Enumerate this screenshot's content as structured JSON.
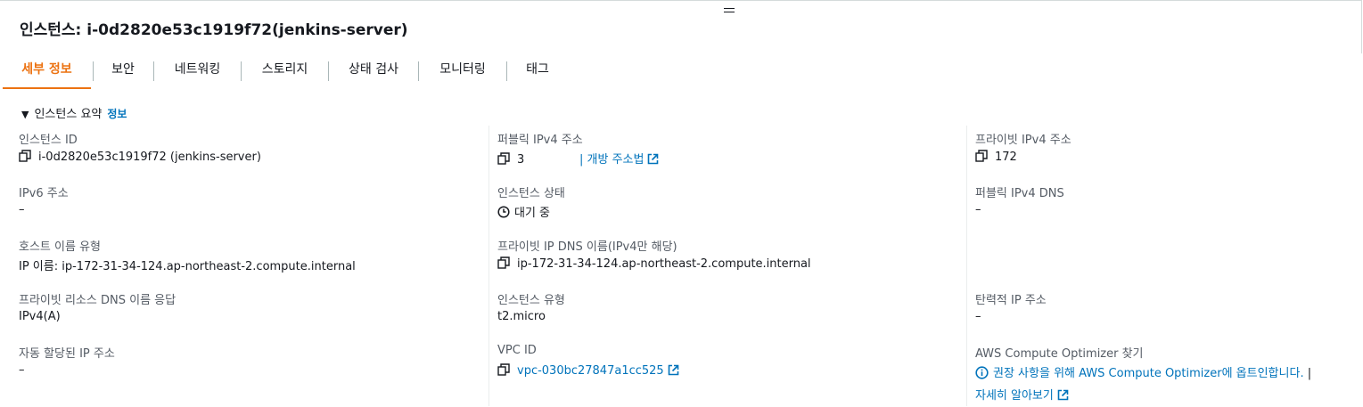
{
  "header": {
    "title": "인스턴스: i-0d2820e53c1919f72(jenkins-server)"
  },
  "tabs": [
    {
      "label": "세부 정보",
      "active": true
    },
    {
      "label": "보안"
    },
    {
      "label": "네트워킹"
    },
    {
      "label": "스토리지"
    },
    {
      "label": "상태 검사"
    },
    {
      "label": "모니터링"
    },
    {
      "label": "태그"
    }
  ],
  "summary": {
    "title": "인스턴스 요약",
    "info_link": "정보"
  },
  "colors": {
    "accent": "#ec7211",
    "link": "#0073bb"
  },
  "fields": {
    "instance_id": {
      "label": "인스턴스 ID",
      "value": "i-0d2820e53c1919f72 (jenkins-server)"
    },
    "public_ipv4": {
      "label": "퍼블릭 IPv4 주소",
      "value": "3",
      "link": "| 개방 주소법"
    },
    "private_ipv4": {
      "label": "프라이빗 IPv4 주소",
      "value": "172"
    },
    "ipv6": {
      "label": "IPv6 주소",
      "value": "–"
    },
    "instance_state": {
      "label": "인스턴스 상태",
      "value": "대기 중"
    },
    "public_ipv4_dns": {
      "label": "퍼블릭 IPv4 DNS",
      "value": "–"
    },
    "hostname_type": {
      "label": "호스트 이름 유형",
      "value": "IP 이름: ip-172-31-34-124.ap-northeast-2.compute.internal"
    },
    "private_ip_dns": {
      "label": "프라이빗 IP DNS 이름(IPv4만 해당)",
      "value": "ip-172-31-34-124.ap-northeast-2.compute.internal"
    },
    "resource_dns": {
      "label": "프라이빗 리소스 DNS 이름 응답",
      "value": "IPv4(A)"
    },
    "instance_type": {
      "label": "인스턴스 유형",
      "value": "t2.micro"
    },
    "elastic_ip": {
      "label": "탄력적 IP 주소",
      "value": "–"
    },
    "auto_ip": {
      "label": "자동 할당된 IP 주소",
      "value": "–"
    },
    "vpc_id": {
      "label": "VPC ID",
      "value": "vpc-030bc27847a1cc525"
    },
    "optimizer": {
      "label": "AWS Compute Optimizer 찾기",
      "value": "권장 사항을 위해 AWS Compute Optimizer에 옵트인합니다.",
      "suffix": "|",
      "learn_more": "자세히 알아보기"
    }
  }
}
